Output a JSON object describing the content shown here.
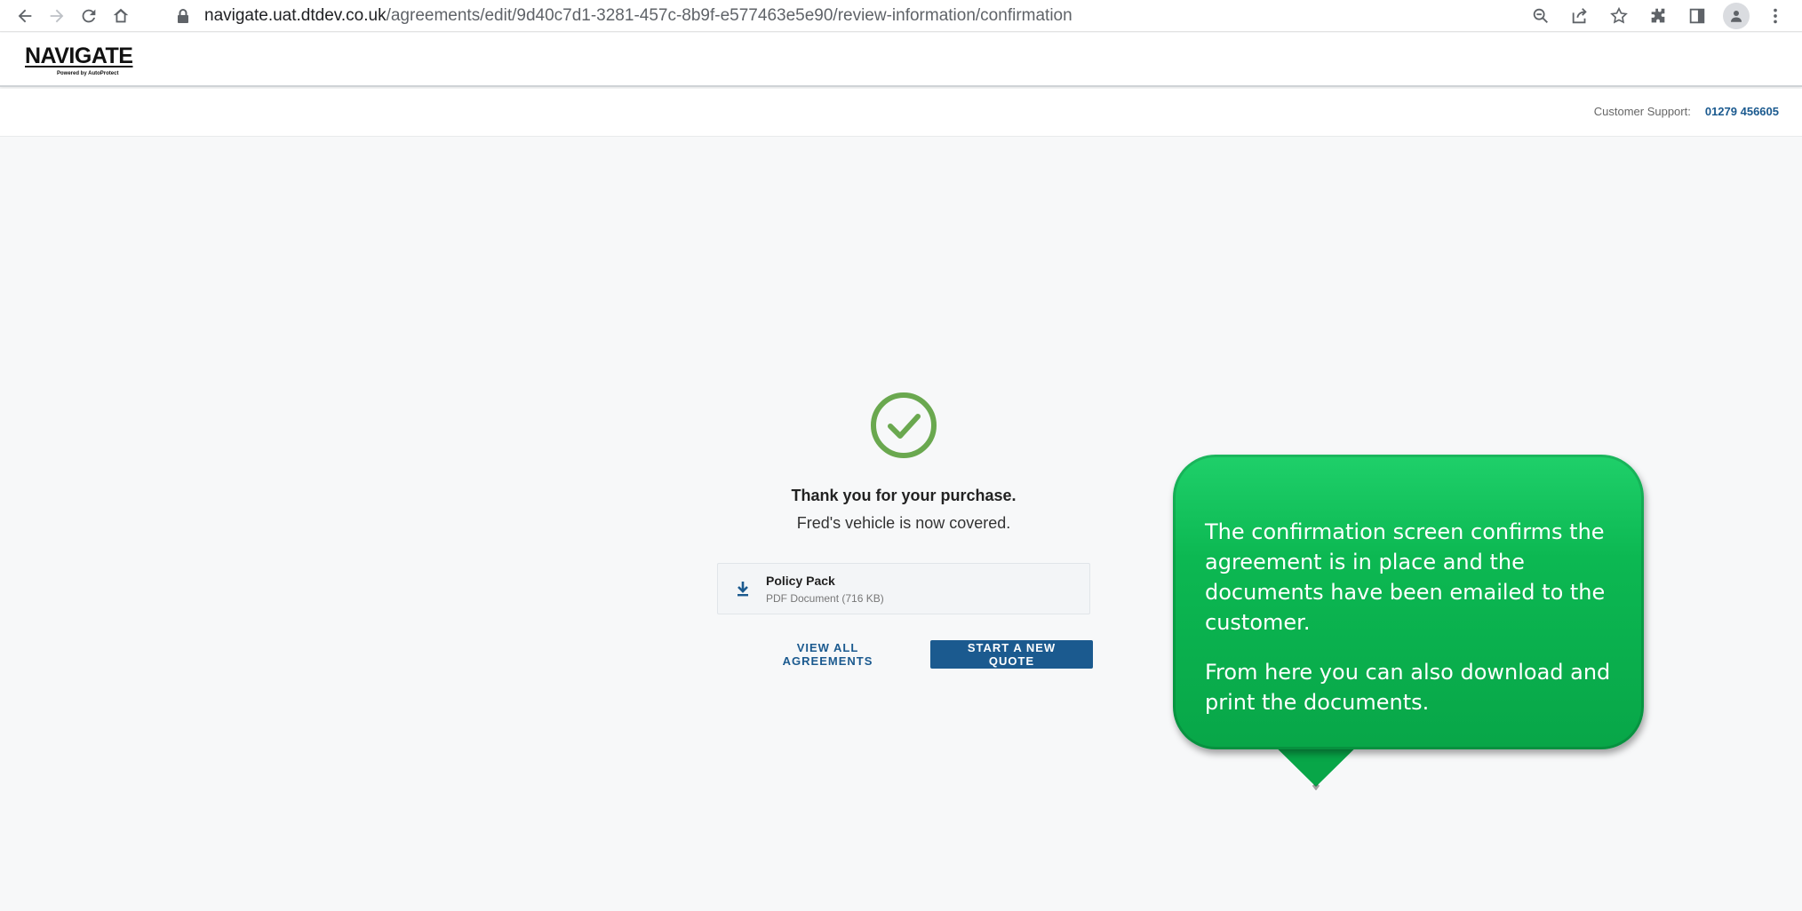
{
  "browser": {
    "url_host": "navigate.uat.dtdev.co.uk",
    "url_path": "/agreements/edit/9d40c7d1-3281-457c-8b9f-e577463e5e90/review-information/confirmation"
  },
  "header": {
    "logo_text": "NAVIGATE",
    "logo_tagline": "Powered by AutoProtect"
  },
  "support": {
    "label": "Customer Support:",
    "phone": "01279 456605"
  },
  "confirmation": {
    "thanks": "Thank you for your purchase.",
    "covered": "Fred's vehicle is now covered."
  },
  "document": {
    "title": "Policy Pack",
    "subtitle": "PDF Document (716 KB)"
  },
  "actions": {
    "view_all": "VIEW ALL AGREEMENTS",
    "new_quote": "START A NEW QUOTE"
  },
  "callout": {
    "paragraph1": "The confirmation screen confirms the agreement is in place and the documents have been emailed to the customer.",
    "paragraph2": "From here you can also download and print the documents."
  },
  "colors": {
    "primary": "#1b5a8f",
    "success": "#6aa84f",
    "callout_green": "#0cb852"
  }
}
